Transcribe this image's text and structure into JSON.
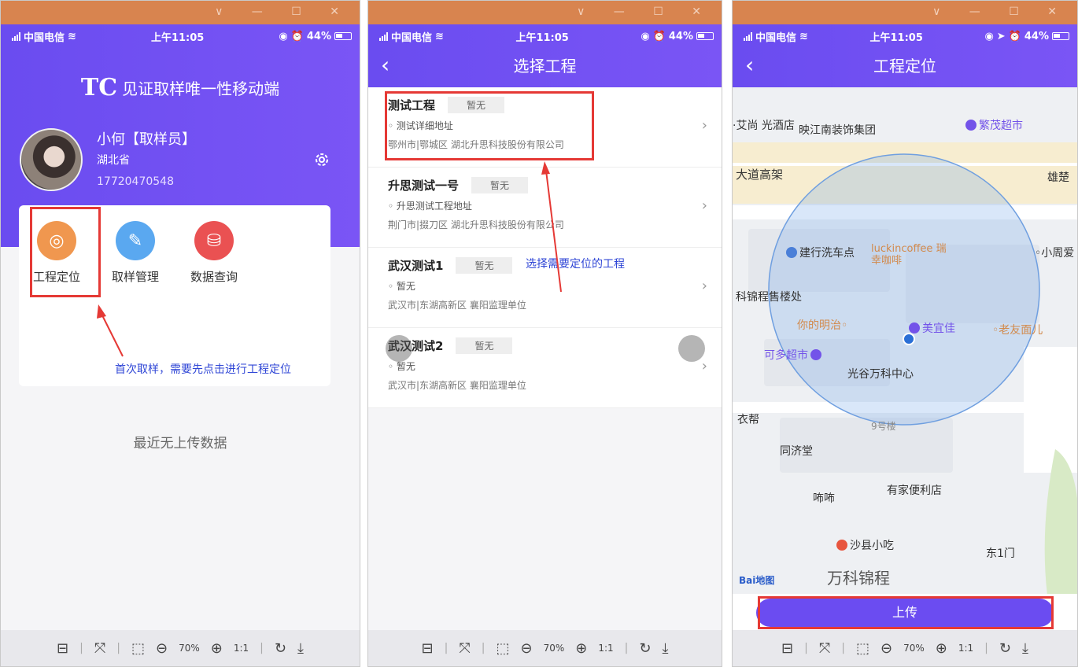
{
  "window_controls": "∨ — ☐ ✕",
  "status": {
    "carrier": "中国电信",
    "time": "上午11:05",
    "battery": "44%"
  },
  "app1": {
    "logo_mark": "TC",
    "title": "见证取样唯一性移动端",
    "user_name": "小何【取样员】",
    "province": "湖北省",
    "phone": "17720470548",
    "functions": [
      {
        "label": "工程定位",
        "icon": "location-signal-icon",
        "color": "#f0974f"
      },
      {
        "label": "取样管理",
        "icon": "pipette-icon",
        "color": "#5aa8f0"
      },
      {
        "label": "数据查询",
        "icon": "database-search-icon",
        "color": "#ea5152"
      }
    ],
    "annotation": "首次取样，需要先点击进行工程定位",
    "empty_text": "最近无上传数据"
  },
  "app2": {
    "nav_title": "选择工程",
    "projects": [
      {
        "name": "测试工程",
        "badge": "暂无",
        "address": "◦ 测试详细地址",
        "org": "鄂州市|鄂城区   湖北升思科技股份有限公司"
      },
      {
        "name": "升思测试一号",
        "badge": "暂无",
        "address": "◦ 升思测试工程地址",
        "org": "荆门市|掇刀区   湖北升思科技股份有限公司"
      },
      {
        "name": "武汉测试1",
        "badge": "暂无",
        "address": "◦ 暂无",
        "org": "武汉市|东湖高新区   襄阳监理单位"
      },
      {
        "name": "武汉测试2",
        "badge": "暂无",
        "address": "◦ 暂无",
        "org": "武汉市|东湖高新区   襄阳监理单位"
      }
    ],
    "annotation": "选择需要定位的工程"
  },
  "app3": {
    "nav_title": "工程定位",
    "pois": {
      "p1": "·艾尚 光酒店",
      "p2": "映江南装饰集团",
      "p3": "繁茂超市",
      "p4": "大道高架",
      "p5": "雄楚",
      "p6": "建行洗车点",
      "p7": "luckincoffee 瑞幸咖啡",
      "p8": "◦小周爱",
      "p9": "科锦程售楼处",
      "p10": "你的明治◦",
      "p11": "美宜佳",
      "p12": "◦老友面儿",
      "p13": "可多超市",
      "p14": "光谷万科中心",
      "p15": "衣帮",
      "p16": "9号楼",
      "p17": "同济堂",
      "p18": "有家便利店",
      "p19": "咘咘",
      "p20": "沙县小吃",
      "p21": "东1门",
      "p22": "万科锦程",
      "p23": "Bai地图"
    },
    "upload_label": "上传"
  },
  "toolbar": {
    "zoom": "70%",
    "fit_label": "1:1"
  }
}
